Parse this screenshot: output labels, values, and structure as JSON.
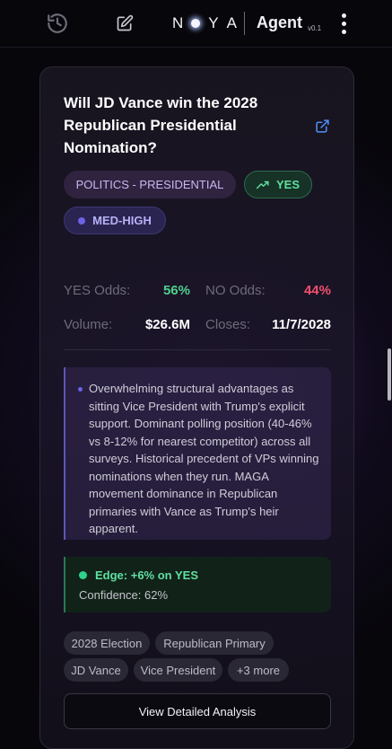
{
  "header": {
    "brand": "NOYA",
    "agent_label": "Agent",
    "version": "v0.1"
  },
  "market": {
    "title": "Will JD Vance win the 2028 Republican Presidential Nomination?",
    "category": "POLITICS - PRESIDENTIAL",
    "recommendation": "YES",
    "confidence_level": "MED-HIGH",
    "stats": {
      "yes_label": "YES Odds:",
      "yes_value": "56%",
      "no_label": "NO Odds:",
      "no_value": "44%",
      "volume_label": "Volume:",
      "volume_value": "$26.6M",
      "closes_label": "Closes:",
      "closes_value": "11/7/2028"
    },
    "analysis": "Overwhelming structural advantages as sitting Vice President with Trump's explicit support. Dominant polling position (40-46% vs 8-12% for nearest competitor) across all surveys. Historical precedent of VPs winning nominations when they run. MAGA movement dominance in Republican primaries with Vance as Trump's heir apparent.",
    "edge": {
      "label": "Edge: +6% on YES",
      "confidence": "Confidence: 62%"
    },
    "tags": [
      "2028 Election",
      "Republican Primary",
      "JD Vance",
      "Vice President",
      "+3 more"
    ],
    "details_button": "View Detailed Analysis"
  },
  "colors": {
    "yes_green": "#5fe0a0",
    "no_red": "#f0506e",
    "accent_purple": "#6b63e6"
  },
  "icons": [
    "history-icon",
    "edit-icon",
    "external-link-icon",
    "trending-up-icon",
    "kebab-menu-icon"
  ]
}
